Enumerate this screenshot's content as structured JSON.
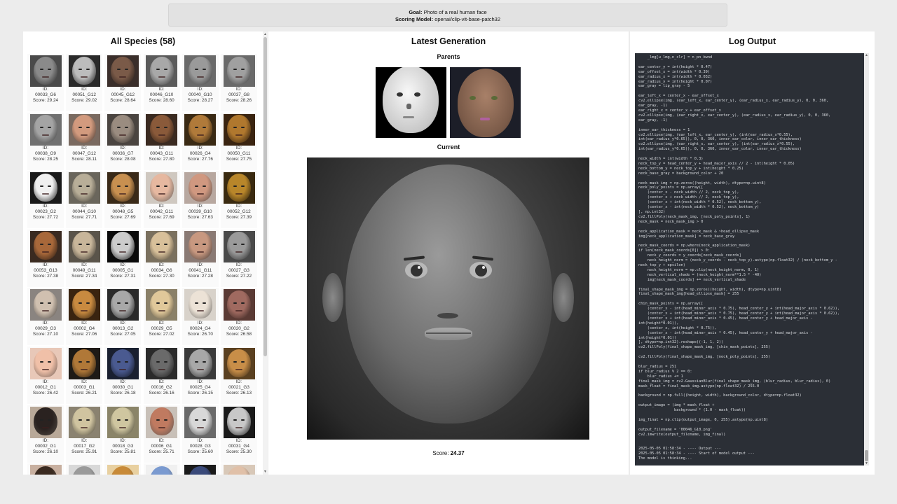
{
  "header": {
    "goal_label": "Goal:",
    "goal_value": "Photo of a real human face",
    "model_label": "Scoring Model:",
    "model_value": "openai/clip-vit-base-patch32"
  },
  "left": {
    "title": "All Species (58)",
    "species": [
      {
        "id": "ID:",
        "name": "00033_G6",
        "score": "Score: 29.24",
        "bg": "#4a4a4a",
        "skin": "#8a8a8a"
      },
      {
        "id": "ID:",
        "name": "00051_G12",
        "score": "Score: 29.02",
        "bg": "#2a2a2a",
        "skin": "#bcbcbc"
      },
      {
        "id": "ID:",
        "name": "00045_G12",
        "score": "Score: 28.64",
        "bg": "#3a2e2a",
        "skin": "#7a5a48"
      },
      {
        "id": "ID:",
        "name": "00046_G10",
        "score": "Score: 28.60",
        "bg": "#5a5a5a",
        "skin": "#a8a8a8"
      },
      {
        "id": "ID:",
        "name": "00040_G10",
        "score": "Score: 28.27",
        "bg": "#6a6a6a",
        "skin": "#9a9a9a"
      },
      {
        "id": "ID:",
        "name": "00037_G8",
        "score": "Score: 28.26",
        "bg": "#6a6a6a",
        "skin": "#a0a0a0"
      },
      {
        "id": "ID:",
        "name": "00038_G9",
        "score": "Score: 28.25",
        "bg": "#707070",
        "skin": "#a4a4a4"
      },
      {
        "id": "ID:",
        "name": "00047_G12",
        "score": "Score: 28.11",
        "bg": "#7a6a60",
        "skin": "#d29a7e"
      },
      {
        "id": "ID:",
        "name": "00036_G7",
        "score": "Score: 28.08",
        "bg": "#4a4440",
        "skin": "#9a8c80"
      },
      {
        "id": "ID:",
        "name": "00043_G11",
        "score": "Score: 27.80",
        "bg": "#3a2a20",
        "skin": "#8a5a3a"
      },
      {
        "id": "ID:",
        "name": "00026_G4",
        "score": "Score: 27.76",
        "bg": "#3a2a14",
        "skin": "#b07a3a"
      },
      {
        "id": "ID:",
        "name": "00050_G11",
        "score": "Score: 27.75",
        "bg": "#3a2410",
        "skin": "#b0782e"
      },
      {
        "id": "ID:",
        "name": "00023_G2",
        "score": "Score: 27.72",
        "bg": "#1a1a1a",
        "skin": "#f0f0f0"
      },
      {
        "id": "ID:",
        "name": "00044_G10",
        "score": "Score: 27.71",
        "bg": "#6a665c",
        "skin": "#b8ae98"
      },
      {
        "id": "ID:",
        "name": "00048_G5",
        "score": "Score: 27.69",
        "bg": "#3a2a18",
        "skin": "#c89050"
      },
      {
        "id": "ID:",
        "name": "00042_G11",
        "score": "Score: 27.69",
        "bg": "#cfc8c0",
        "skin": "#e6b8a0"
      },
      {
        "id": "ID:",
        "name": "00039_G10",
        "score": "Score: 27.63",
        "bg": "#b8a8a0",
        "skin": "#d09880"
      },
      {
        "id": "ID:",
        "name": "00052_G12",
        "score": "Score: 27.39",
        "bg": "#3a2a10",
        "skin": "#b8862a"
      },
      {
        "id": "ID:",
        "name": "00053_G13",
        "score": "Score: 27.38",
        "bg": "#3a2a20",
        "skin": "#a8683a"
      },
      {
        "id": "ID:",
        "name": "00049_G11",
        "score": "Score: 27.34",
        "bg": "#5a544a",
        "skin": "#c8b69a"
      },
      {
        "id": "ID:",
        "name": "00005_G1",
        "score": "Score: 27.31",
        "bg": "#0a0a0a",
        "skin": "#cccccc"
      },
      {
        "id": "ID:",
        "name": "00034_G6",
        "score": "Score: 27.30",
        "bg": "#7a705e",
        "skin": "#d8c09a"
      },
      {
        "id": "ID:",
        "name": "00041_G11",
        "score": "Score: 27.28",
        "bg": "#8a7a74",
        "skin": "#c89880"
      },
      {
        "id": "ID:",
        "name": "00027_G3",
        "score": "Score: 27.22",
        "bg": "#4a4a4a",
        "skin": "#9a9a9a"
      },
      {
        "id": "ID:",
        "name": "00029_G3",
        "score": "Score: 27.10",
        "bg": "#8a8480",
        "skin": "#d0c0b0"
      },
      {
        "id": "ID:",
        "name": "00002_G4",
        "score": "Score: 27.06",
        "bg": "#3a2410",
        "skin": "#c88a40"
      },
      {
        "id": "ID:",
        "name": "00013_G2",
        "score": "Score: 27.05",
        "bg": "#2a2a2a",
        "skin": "#a8a8a8"
      },
      {
        "id": "ID:",
        "name": "00029_G5",
        "score": "Score: 27.02",
        "bg": "#8a8068",
        "skin": "#e0c89a"
      },
      {
        "id": "ID:",
        "name": "00024_G4",
        "score": "Score: 26.70",
        "bg": "#d8d2ca",
        "skin": "#ece2d6"
      },
      {
        "id": "ID:",
        "name": "00020_G2",
        "score": "Score: 26.58",
        "bg": "#5a3a34",
        "skin": "#a06a60"
      },
      {
        "id": "ID:",
        "name": "00012_G1",
        "score": "Score: 26.42",
        "bg": "#e8c8b8",
        "skin": "#f0c0a8"
      },
      {
        "id": "ID:",
        "name": "00003_G1",
        "score": "Score: 26.21",
        "bg": "#1e1a16",
        "skin": "#b07838"
      },
      {
        "id": "ID:",
        "name": "00030_G1",
        "score": "Score: 26.18",
        "bg": "#1a2030",
        "skin": "#4a5a90"
      },
      {
        "id": "ID:",
        "name": "00016_G2",
        "score": "Score: 26.16",
        "bg": "#2a2a2a",
        "skin": "#6a6a6a"
      },
      {
        "id": "ID:",
        "name": "00025_G4",
        "score": "Score: 26.15",
        "bg": "#3a3a3a",
        "skin": "#a8a8a8"
      },
      {
        "id": "ID:",
        "name": "00021_G3",
        "score": "Score: 26.13",
        "bg": "#5a4020",
        "skin": "#c88e48"
      },
      {
        "id": "ID:",
        "name": "00002_G1",
        "score": "Score: 26.10",
        "bg": "#b8a898",
        "skin": "#2a2220"
      },
      {
        "id": "ID:",
        "name": "00017_G2",
        "score": "Score: 25.91",
        "bg": "#8a8270",
        "skin": "#d0c4a0"
      },
      {
        "id": "ID:",
        "name": "00018_G3",
        "score": "Score: 25.81",
        "bg": "#8a8468",
        "skin": "#cfc6a0"
      },
      {
        "id": "ID:",
        "name": "00006_G1",
        "score": "Score: 25.71",
        "bg": "#c8c0b8",
        "skin": "#c07a60"
      },
      {
        "id": "ID:",
        "name": "00028_G3",
        "score": "Score: 25.60",
        "bg": "#6a6a6a",
        "skin": "#d8d8d8"
      },
      {
        "id": "ID:",
        "name": "00031_G4",
        "score": "Score: 25.30",
        "bg": "#1a1a1a",
        "skin": "#c8c8c8"
      },
      {
        "id": "",
        "name": "",
        "score": "",
        "bg": "#c8b0a0",
        "skin": "#3a2a20"
      },
      {
        "id": "",
        "name": "",
        "score": "",
        "bg": "#d8d8d8",
        "skin": "#9a9a9a"
      },
      {
        "id": "",
        "name": "",
        "score": "",
        "bg": "#e8d0a0",
        "skin": "#c88a38"
      },
      {
        "id": "",
        "name": "",
        "score": "",
        "bg": "#f0f0f0",
        "skin": "#7a9ad0"
      },
      {
        "id": "",
        "name": "",
        "score": "",
        "bg": "#1a1a1a",
        "skin": "#3a4a7a"
      },
      {
        "id": "",
        "name": "",
        "score": "",
        "bg": "#d8c8b8",
        "skin": "#e0c0a8"
      }
    ]
  },
  "middle": {
    "title": "Latest Generation",
    "parents_label": "Parents",
    "current_label": "Current",
    "score_label": "Score:",
    "score_value": "24.37"
  },
  "right": {
    "title": "Log Output",
    "log": "    _lmg[u_lmg,n_clr] = n_pn_bwnd\n\near_center_y = int(height * 0.47)\near_offset_x = int(width * 0.39)\near_radius_x = int(width * 0.032)\near_radius_y = int(height * 0.07)\near_gray = lip_gray - 5\n\near_left_x = center_x - ear_offset_x\ncv2.ellipse(img, (ear_left_x, ear_center_y), (ear_radius_x, ear_radius_y), 0, 0, 360,\near_gray, -1)\near_right_x = center_x + ear_offset_x\ncv2.ellipse(img, (ear_right_x, ear_center_y), (ear_radius_x, ear_radius_y), 0, 0, 360,\near_gray, -1)\n\ninner_ear_thickness = 1\ncv2.ellipse(img, (ear_left_x, ear_center_y), (int(ear_radius_x*0.55),\nint(ear_radius_y*0.65)), 0, 0, 360, inner_ear_color, inner_ear_thickness)\ncv2.ellipse(img, (ear_right_x, ear_center_y), (int(ear_radius_x*0.55),\nint(ear_radius_y*0.65)), 0, 0, 360, inner_ear_color, inner_ear_thickness)\n\nneck_width = int(width * 0.3)\nneck_top_y = head_center_y + head_major_axis // 2 - int(height * 0.05)\nneck_bottom_y = neck_top_y + int(height * 0.25)\nneck_base_gray = background_color + 20\n\nneck_mask_img = np.zeros((height, width), dtype=np.uint8)\nneck_poly_points = np.array([\n    (center_x - neck_width // 2, neck_top_y),\n    (center_x + neck_width // 2, neck_top_y),\n    (center_x + int(neck_width * 0.52), neck_bottom_y),\n    (center_x - int(neck_width * 0.52), neck_bottom_y)\n], np.int32)\ncv2.fillPoly(neck_mask_img, [neck_poly_points], 1)\nneck_mask = neck_mask_img > 0\n\nneck_application_mask = neck_mask & ~head_ellipse_mask\nimg[neck_application_mask] = neck_base_gray\n\nneck_mask_coords = np.where(neck_application_mask)\nif len(neck_mask_coords[0]) > 0:\n    neck_y_coords = y_coords[neck_mask_coords]\n    neck_height_norm = (neck_y_coords - neck_top_y).astype(np.float32) / (neck_bottom_y -\nneck_top_y + epsilon)\n    neck_height_norm = np.clip(neck_height_norm, 0, 1)\n    neck_vertical_shade = (neck_height_norm**1.5 * -40)\n    img[neck_mask_coords] += neck_vertical_shade\n\nfinal_shape_mask_img = np.zeros((height, width), dtype=np.uint8)\nfinal_shape_mask_img[head_ellipse_mask] = 255\n\nchin_mask_points = np.array([\n    (center_x - int(head_minor_axis * 0.75), head_center_y + int(head_major_axis * 0.62)),\n    (center_x + int(head_minor_axis * 0.75), head_center_y + int(head_major_axis * 0.62)),\n    (center_x + int(head_minor_axis * 0.45), head_center_y + head_major_axis -\nint(height*0.01)),\n    (center_x, int(height * 0.75)),\n    (center_x - int(head_minor_axis * 0.45), head_center_y + head_major_axis -\nint(height*0.01))\n], dtype=np.int32).reshape((-1, 1, 2))\ncv2.fillPoly(final_shape_mask_img, [chin_mask_points], 255)\n\ncv2.fillPoly(final_shape_mask_img, [neck_poly_points], 255)\n\nblur_radius = 251\nif blur_radius % 2 == 0:\n    blur_radius += 1\nfinal_mask_img = cv2.GaussianBlur(final_shape_mask_img, (blur_radius, blur_radius), 0)\nmask_float = final_mask_img.astype(np.float32) / 255.0\n\nbackground = np.full((height, width), background_color, dtype=np.float32)\n\noutput_image = (img * mask_float +\n                background * (1.0 - mask_float))\n\nimg_final = np.clip(output_image, 0, 255).astype(np.uint8)\n\noutput_filename = '00046_G10.png'\ncv2.imwrite(output_filename, img_final)\n\n\n2025-05-05 01:58:34 - ---- Output ---\n2025-05-05 01:58:34 - ---- Start of model output ---\nThe model is thinking..."
  }
}
